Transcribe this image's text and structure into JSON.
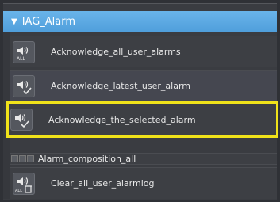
{
  "group": {
    "title": "IAG_Alarm",
    "expanded": true
  },
  "items": [
    {
      "label": "Acknowledge_all_user_alarms",
      "icon": "speaker-all-icon"
    },
    {
      "label": "Acknowledge_latest_user_alarm",
      "icon": "speaker-check-icon"
    },
    {
      "label": "Acknowledge_the_selected_alarm",
      "icon": "speaker-check-icon",
      "selected": true
    },
    {
      "label": "Alarm_composition_all",
      "icon": "composition-icons"
    },
    {
      "label": "Clear_all_user_alarmlog",
      "icon": "speaker-trash-icon"
    }
  ],
  "colors": {
    "header": "#5aa8e2",
    "highlight": "#f0e21a",
    "background": "#3a3c41"
  }
}
